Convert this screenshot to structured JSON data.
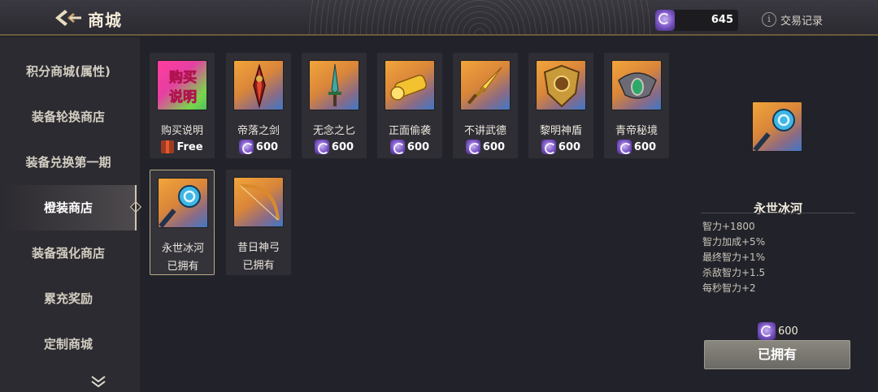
{
  "header": {
    "title": "商城",
    "currency_amount": "645",
    "trade_log_label": "交易记录",
    "info_glyph": "i"
  },
  "sidebar": {
    "items": [
      {
        "label": "积分商城(属性)"
      },
      {
        "label": "装备轮换商店"
      },
      {
        "label": "装备兑换第一期"
      },
      {
        "label": "橙装商店",
        "active": true
      },
      {
        "label": "装备强化商店"
      },
      {
        "label": "累充奖励"
      },
      {
        "label": "定制商城"
      }
    ]
  },
  "shop": {
    "items": [
      {
        "name": "购买说明",
        "price": "Free",
        "icon": "buy-instructions-icon",
        "thumb_text": "购买说明"
      },
      {
        "name": "帝落之剑",
        "price": "600",
        "icon": "sword-icon"
      },
      {
        "name": "无念之匕",
        "price": "600",
        "icon": "dagger-icon"
      },
      {
        "name": "正面偷袭",
        "price": "600",
        "icon": "golden-cannon-icon"
      },
      {
        "name": "不讲武德",
        "price": "600",
        "icon": "golden-blade-icon"
      },
      {
        "name": "黎明神盾",
        "price": "600",
        "icon": "shield-icon"
      },
      {
        "name": "青帝秘境",
        "price": "600",
        "icon": "amulet-icon"
      },
      {
        "name": "永世冰河",
        "status": "已拥有",
        "icon": "ice-staff-icon",
        "selected": true
      },
      {
        "name": "昔日神弓",
        "status": "已拥有",
        "icon": "bow-icon"
      }
    ]
  },
  "detail": {
    "name": "永世冰河",
    "stats": [
      "智力+1800",
      "智力加成+5%",
      "最终智力+1%",
      "杀敌智力+1.5",
      "每秒智力+2"
    ],
    "price": "600",
    "button_label": "已拥有",
    "icon": "ice-staff-icon"
  },
  "colors": {
    "accent": "#b8ab86",
    "gem": "#7a53c4",
    "thumb_orange": "#f2a53a",
    "thumb_blue": "#3f78c7"
  }
}
